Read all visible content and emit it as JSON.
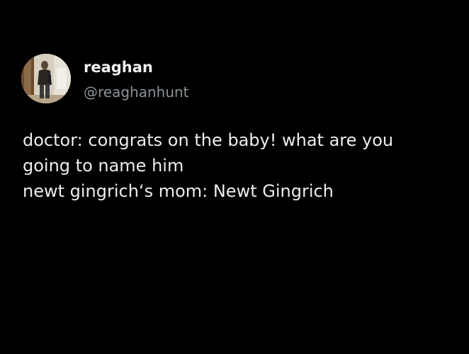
{
  "author": {
    "display_name": "reaghan",
    "handle": "@reaghanhunt",
    "avatar_icon": "profile-photo"
  },
  "tweet": {
    "lines": [
      "doctor: congrats on the baby! what are you",
      "going to name him",
      "newt gingrich‘s mom: Newt Gingrich"
    ]
  },
  "colors": {
    "background": "#000000",
    "name_text": "#f2f2f2",
    "handle_text": "#8b9196",
    "body_text": "#ededed"
  }
}
